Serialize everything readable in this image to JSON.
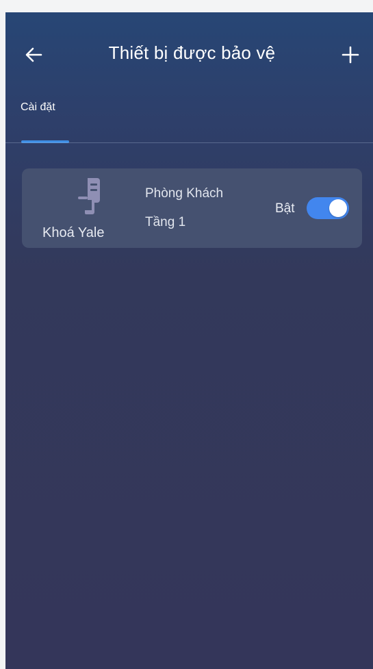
{
  "header": {
    "title": "Thiết bị được bảo vệ",
    "back_icon": "arrow-left-icon",
    "add_icon": "plus-icon"
  },
  "tabs": [
    {
      "label": "Cài đặt",
      "active": true
    }
  ],
  "devices": [
    {
      "name": "Khoá Yale",
      "icon": "door-lock-icon",
      "room": "Phòng Khách",
      "floor": "Tầng 1",
      "status_label": "Bật",
      "enabled": true
    }
  ],
  "colors": {
    "accent": "#3f8fe6",
    "toggle_on": "#4286ee",
    "card_background": "#455170",
    "screen_background_top": "#274675",
    "screen_background_bottom": "#34365a",
    "lock_icon": "#8f8fb4"
  }
}
